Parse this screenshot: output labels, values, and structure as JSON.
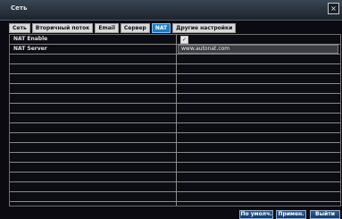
{
  "window": {
    "title": "Сеть",
    "close_label": "×"
  },
  "tabs": [
    {
      "label": "Сеть",
      "active": false
    },
    {
      "label": "Вторичный поток",
      "active": false
    },
    {
      "label": "Email",
      "active": false
    },
    {
      "label": "Сервер",
      "active": false
    },
    {
      "label": "NAT",
      "active": true
    },
    {
      "label": "Другие настройки",
      "active": false
    }
  ],
  "settings": {
    "nat_enable": {
      "label": "NAT Enable",
      "checked": true,
      "check_glyph": "✓"
    },
    "nat_server": {
      "label": "NAT Server",
      "value": "www.autonat.com"
    }
  },
  "buttons": {
    "default": "По умолч.",
    "apply": "Примен.",
    "exit": "Выйти"
  },
  "colors": {
    "accent": "#1c7fc4",
    "background": "#0b0b12"
  }
}
